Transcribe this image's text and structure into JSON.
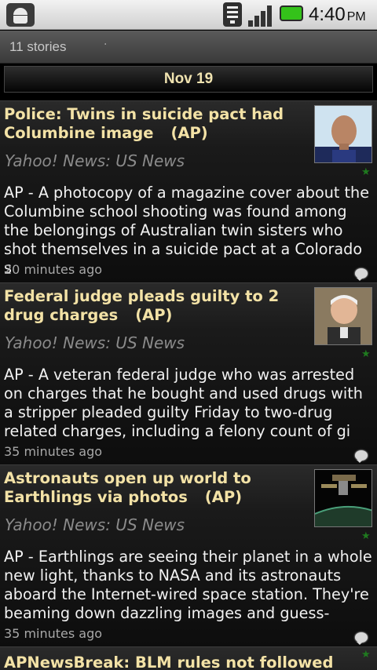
{
  "status_bar": {
    "time": "4:40",
    "ampm": "PM",
    "icons": [
      "android-debug-icon",
      "wifi-icon",
      "signal-icon",
      "battery-icon"
    ]
  },
  "header": {
    "story_count": "11 stories",
    "date": "Nov 19"
  },
  "stories": [
    {
      "title": "Police: Twins in suicide pact had Columbine image",
      "source": "(AP)",
      "feed": "Yahoo! News: US News",
      "description": "AP - A photocopy of a magazine cover about the Columbine school shooting was found among the belongings of Australian twin sisters who shot themselves in a suicide pact at a Colorado s",
      "time_ago": "20 minutes ago"
    },
    {
      "title": "Federal judge pleads guilty to 2 drug charges",
      "source": "(AP)",
      "feed": "Yahoo! News: US News",
      "description": "AP - A veteran federal judge who was arrested on charges that he bought and used drugs with a stripper pleaded guilty Friday to two-drug related charges, including a felony count of gi",
      "time_ago": "35 minutes ago"
    },
    {
      "title": "Astronauts open up world to Earthlings via photos",
      "source": "(AP)",
      "feed": "Yahoo! News: US News",
      "description": "AP - Earthlings are seeing their planet in a whole new light, thanks to NASA and its astronauts aboard the Internet-wired space station. They're beaming down dazzling images and guess-",
      "time_ago": "35 minutes ago"
    },
    {
      "title": "APNewsBreak: BLM rules not followed"
    }
  ],
  "colors": {
    "title": "#f3e2a6",
    "feed": "#8b8b8b",
    "body_text": "#f2f2f2",
    "battery": "#34c21a",
    "star": "#1f7a1f"
  }
}
